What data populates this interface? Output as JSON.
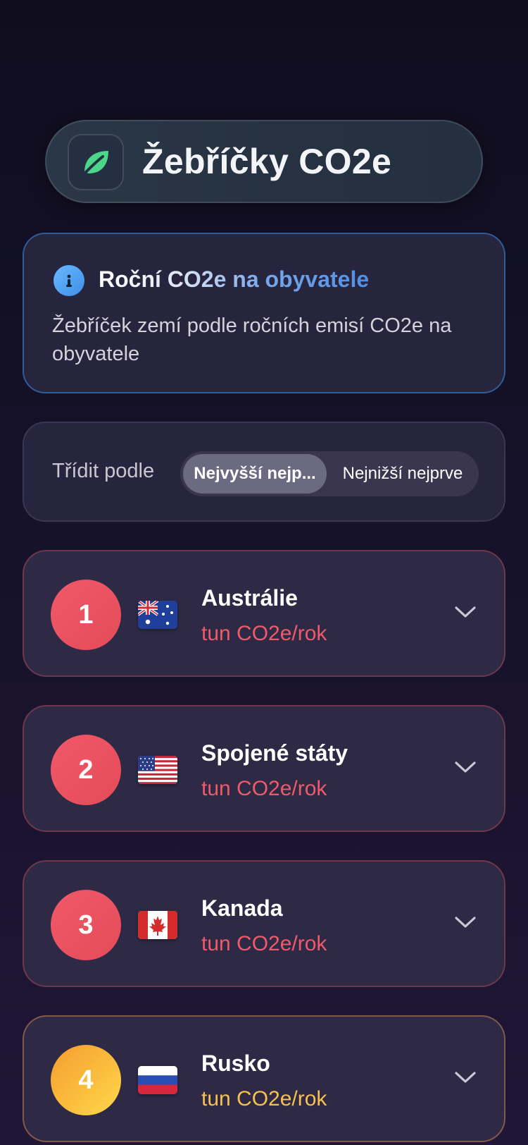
{
  "header": {
    "title": "Žebříčky CO2e",
    "icon": "leaf-icon",
    "accent": "#4bd68a"
  },
  "info": {
    "icon": "info-icon",
    "title": "Roční CO2e na obyvatele",
    "description": "Žebříček zemí podle ročních emisí CO2e na obyvatele"
  },
  "sort": {
    "label": "Třídit podle",
    "options": [
      "Nejvyšší nejp...",
      "Nejnižší nejprve"
    ],
    "selected": "Nejvyšší nejp..."
  },
  "rankings": [
    {
      "rank": "1",
      "country": "Austrálie",
      "flag": "australia-flag-icon",
      "unit": "tun CO2e/rok",
      "color": "#ef5a6b"
    },
    {
      "rank": "2",
      "country": "Spojené státy",
      "flag": "usa-flag-icon",
      "unit": "tun CO2e/rok",
      "color": "#ef5a6b"
    },
    {
      "rank": "3",
      "country": "Kanada",
      "flag": "canada-flag-icon",
      "unit": "tun CO2e/rok",
      "color": "#ef5a6b"
    },
    {
      "rank": "4",
      "country": "Rusko",
      "flag": "russia-flag-icon",
      "unit": "tun CO2e/rok",
      "color": "#f7c14e"
    }
  ]
}
